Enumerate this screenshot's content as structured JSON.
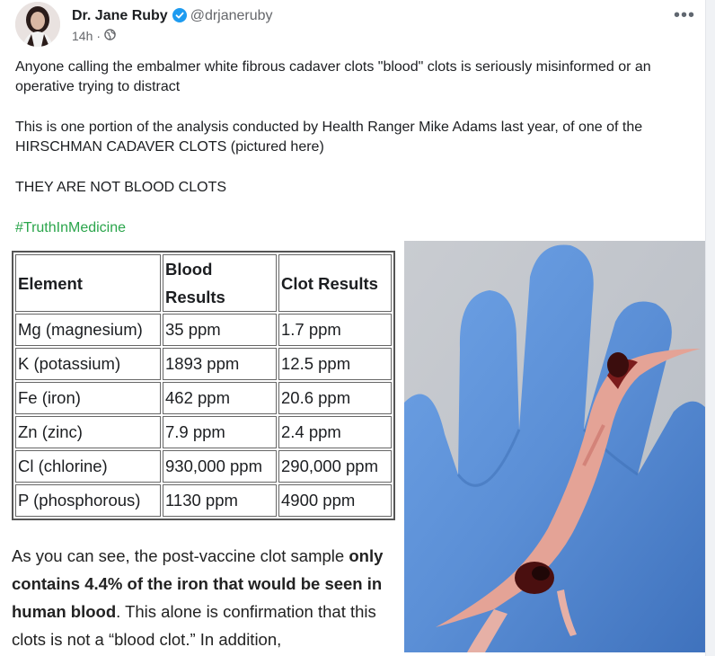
{
  "author": {
    "name": "Dr. Jane Ruby",
    "handle": "@drjaneruby",
    "time": "14h",
    "separator": "·"
  },
  "post": {
    "paragraph1": "Anyone calling the embalmer white fibrous cadaver clots \"blood\" clots is seriously misinformed or an operative trying to distract",
    "paragraph2": "This is one portion of the analysis conducted by Health Ranger Mike Adams last year, of one of the HIRSCHMAN CADAVER CLOTS (pictured here)",
    "paragraph3": "THEY ARE NOT BLOOD CLOTS",
    "hashtag": "#TruthInMedicine"
  },
  "table": {
    "headers": [
      "Element",
      "Blood Results",
      "Clot Results"
    ],
    "rows": [
      [
        "Mg (magnesium)",
        "35 ppm",
        "1.7 ppm"
      ],
      [
        "K (potassium)",
        "1893 ppm",
        "12.5 ppm"
      ],
      [
        "Fe (iron)",
        "462 ppm",
        "20.6 ppm"
      ],
      [
        "Zn (zinc)",
        "7.9 ppm",
        "2.4 ppm"
      ],
      [
        "Cl (chlorine)",
        "930,000 ppm",
        "290,000 ppm"
      ],
      [
        "P (phosphorous)",
        "1130 ppm",
        "4900 ppm"
      ]
    ]
  },
  "caption": {
    "part1": "As you can see, the post-vaccine clot sample ",
    "bold": "only contains 4.4% of the iron that would be seen in human blood",
    "part2": ". This alone is confirmation that this clots is not a “blood clot.” In addition,"
  },
  "icons": {
    "verified": "verified-badge-icon",
    "audience": "globe-icon",
    "more": "more-options-icon"
  },
  "colors": {
    "verified": "#1d9bf0",
    "hashtag": "#2aa54b",
    "glove": "#5b8fd6"
  }
}
